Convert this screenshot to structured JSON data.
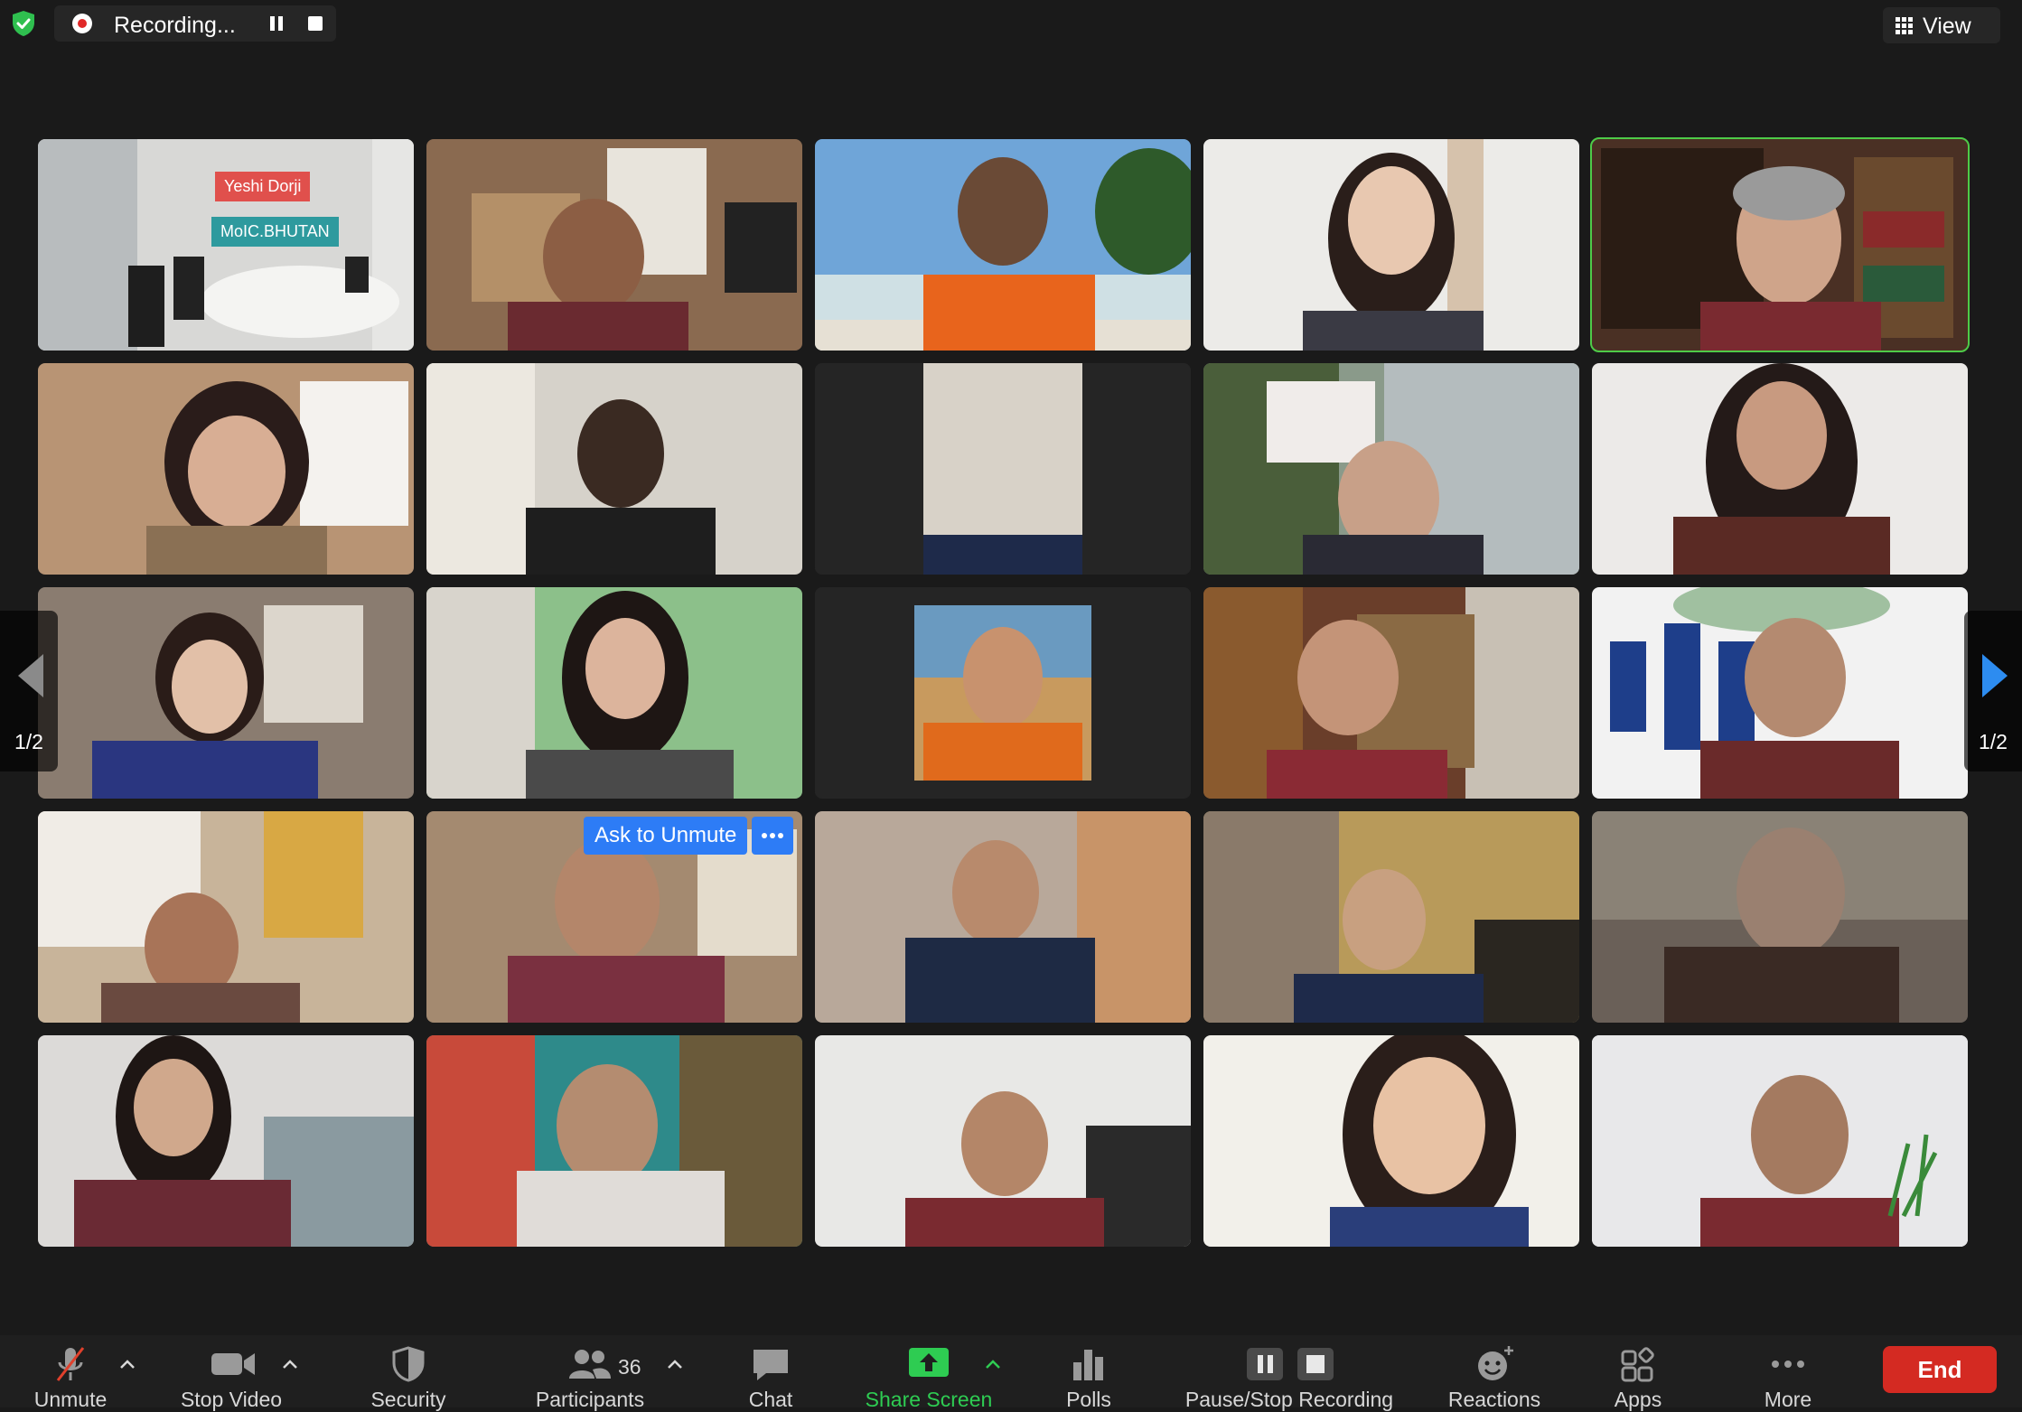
{
  "top_bar": {
    "recording_text": "Recording...",
    "view_label": "View"
  },
  "tiles": {
    "t1": {
      "name_card_line1": "Yeshi Dorji",
      "name_card_line2": "MoIC.BHUTAN"
    }
  },
  "tile_overlay": {
    "ask_to_unmute": "Ask to Unmute"
  },
  "paging": {
    "left_label": "1/2",
    "right_label": "1/2"
  },
  "toolbar": {
    "unmute": "Unmute",
    "stop_video": "Stop Video",
    "security": "Security",
    "participants": "Participants",
    "participants_count": "36",
    "chat": "Chat",
    "share_screen": "Share Screen",
    "polls": "Polls",
    "pause_stop_recording": "Pause/Stop Recording",
    "reactions": "Reactions",
    "apps": "Apps",
    "more": "More",
    "end": "End"
  },
  "colors": {
    "accent_blue": "#2d7cf6",
    "active_speaker_green": "#4ecb48",
    "end_red": "#d42a22",
    "share_green": "#2ecc52",
    "recording_red": "#e02828"
  }
}
